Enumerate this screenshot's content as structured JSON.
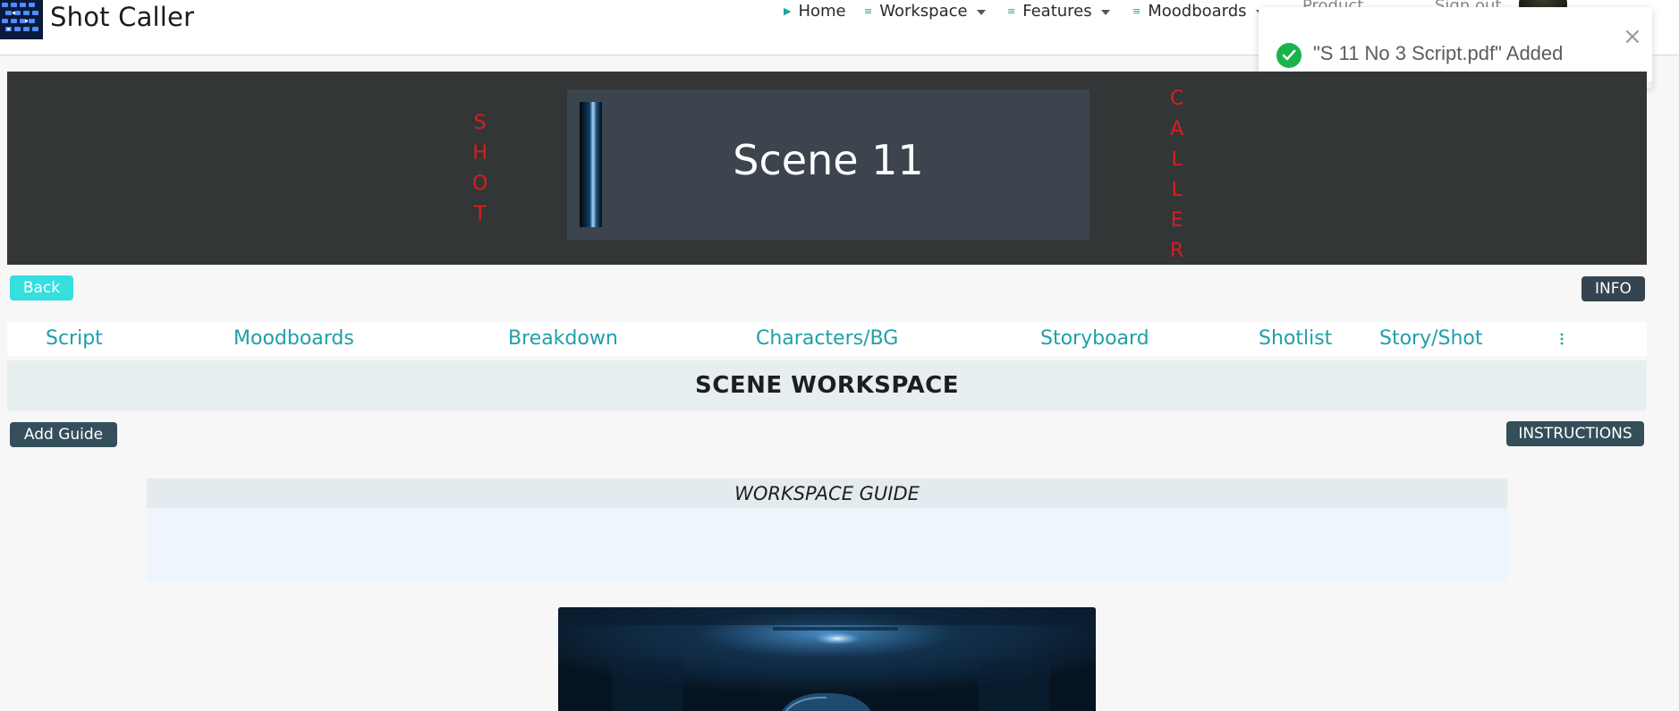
{
  "navbar": {
    "brand": "Shot Caller",
    "logo_icon": "film-grid-logo",
    "items": [
      {
        "label": "Home",
        "bullet": "▶"
      },
      {
        "label": "Workspace",
        "bullet": "≡"
      },
      {
        "label": "Features",
        "bullet": "≡"
      },
      {
        "label": "Moodboards",
        "bullet": "≡"
      }
    ],
    "partial_items": [
      "Product",
      "Sign out"
    ]
  },
  "toast": {
    "message": "\"S 11 No 3 Script.pdf\" Added",
    "close_glyph": "×",
    "progress": 0.535,
    "color_success": "#19b34b"
  },
  "hero": {
    "left_word": [
      "S",
      "H",
      "O",
      "T"
    ],
    "right_word": [
      "C",
      "A",
      "L",
      "L",
      "E",
      "R"
    ],
    "title": "Scene 11",
    "accent_color": "#d91e1e"
  },
  "buttons": {
    "back": "Back",
    "info": "INFO",
    "add_guide": "Add Guide",
    "instructions": "INSTRUCTIONS"
  },
  "tabs": [
    "Script",
    "Moodboards",
    "Breakdown",
    "Characters/BG",
    "Storyboard",
    "Shotlist",
    "Story/Shot"
  ],
  "tabs_more_icon": "vertical-ellipsis-icon",
  "section": {
    "title": "SCENE WORKSPACE"
  },
  "guide": {
    "title": "WORKSPACE GUIDE"
  },
  "colors": {
    "teal": "#1f9fa9",
    "cyan_button": "#36dede",
    "dark_button": "#344e5a",
    "hero_bg": "#333637"
  }
}
